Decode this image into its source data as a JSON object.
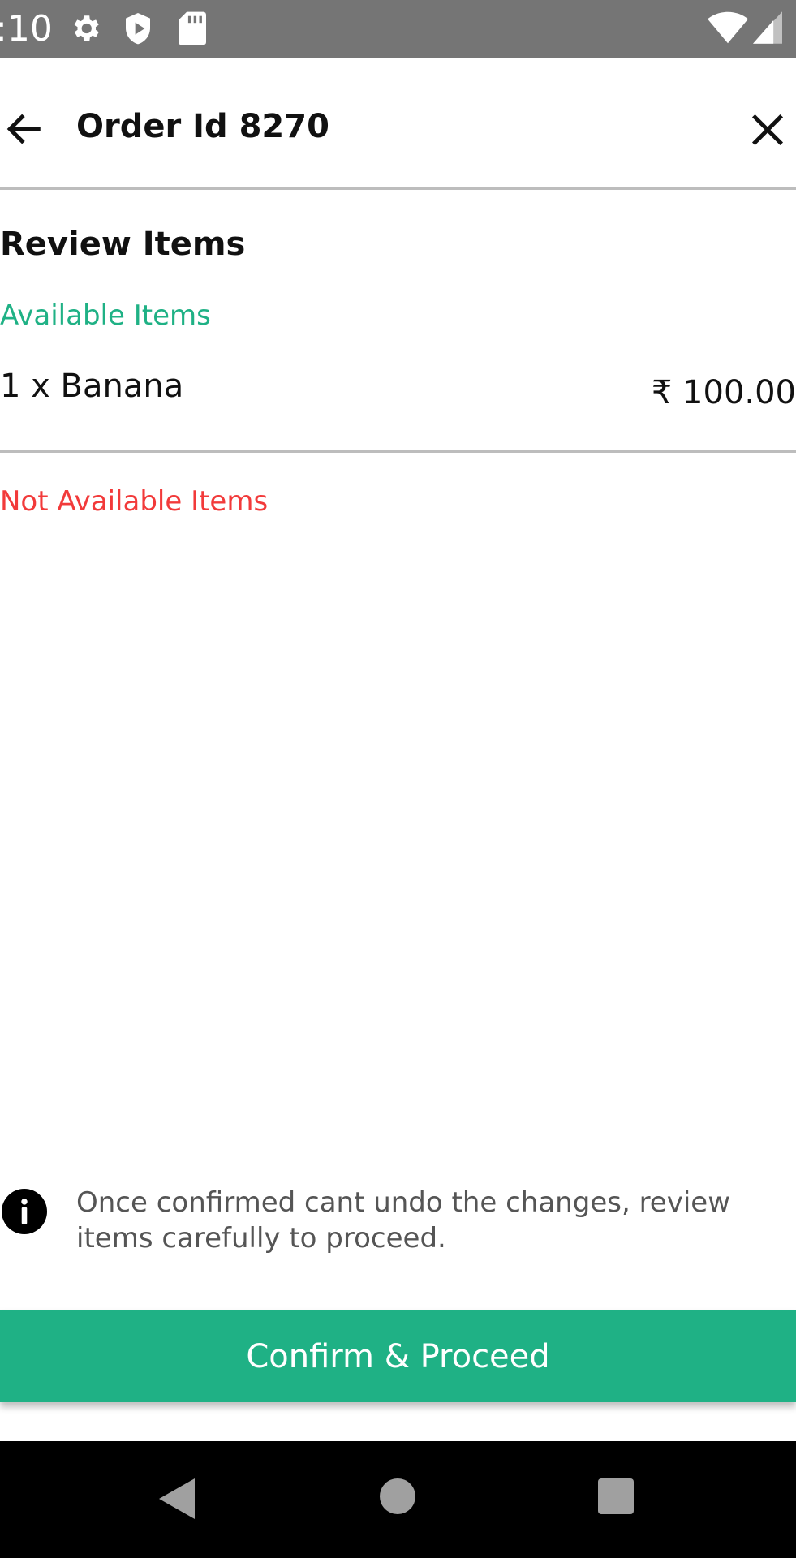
{
  "status_bar": {
    "time": ":10",
    "icons": [
      "settings-icon",
      "shield-icon",
      "sd-card-icon",
      "wifi-icon",
      "cell-signal-icon"
    ]
  },
  "app_bar": {
    "title": "Order Id 8270",
    "back_icon": "arrow-left-icon",
    "close_icon": "close-icon"
  },
  "review": {
    "heading": "Review Items",
    "available_label": "Available Items",
    "available_items": [
      {
        "name": "1 x Banana",
        "price": "₹ 100.00"
      }
    ],
    "not_available_label": "Not Available Items",
    "not_available_items": []
  },
  "info": {
    "icon": "info-icon",
    "text": "Once confirmed cant undo the changes, review items carefully to proceed."
  },
  "confirm_button": {
    "label": "Confirm & Proceed"
  },
  "nav_bar": {
    "icons": [
      "back-triangle-icon",
      "home-circle-icon",
      "recents-square-icon"
    ]
  },
  "colors": {
    "accent": "#1fb185",
    "error": "#f23a3a",
    "status_bar": "#757575",
    "nav_bar": "#000000"
  }
}
